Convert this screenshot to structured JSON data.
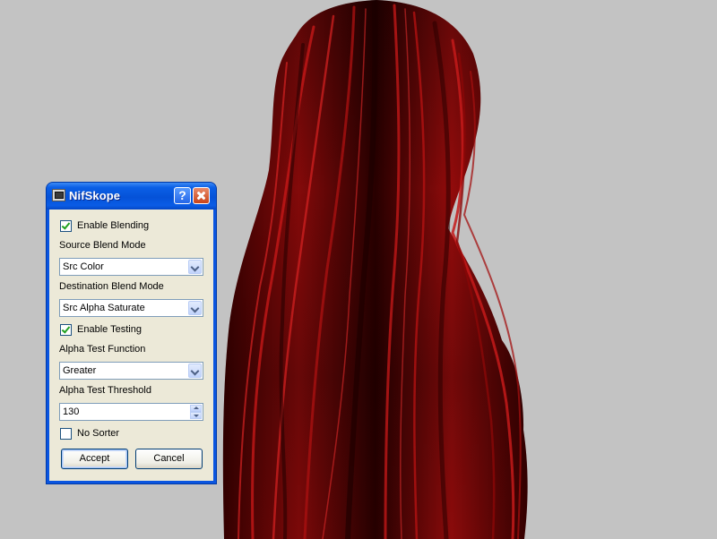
{
  "window": {
    "title": "NifSkope",
    "help_label": "?",
    "close_icon": "close-icon",
    "app_icon": "nifskope-app-icon"
  },
  "form": {
    "enable_blending": {
      "label": "Enable Blending",
      "checked": true
    },
    "source_blend_mode": {
      "label": "Source Blend Mode",
      "value": "Src Color"
    },
    "destination_blend_mode": {
      "label": "Destination Blend Mode",
      "value": "Src Alpha Saturate"
    },
    "enable_testing": {
      "label": "Enable Testing",
      "checked": true
    },
    "alpha_test_function": {
      "label": "Alpha Test Function",
      "value": "Greater"
    },
    "alpha_test_threshold": {
      "label": "Alpha Test Threshold",
      "value": "130"
    },
    "no_sorter": {
      "label": "No Sorter",
      "checked": false
    }
  },
  "buttons": {
    "accept": "Accept",
    "cancel": "Cancel"
  },
  "colors": {
    "viewport_background": "#c3c3c3",
    "hair_dark": "#2a0000",
    "hair_red": "#b01010",
    "titlebar_blue": "#0a55e0",
    "dialog_face": "#ece9d8"
  }
}
